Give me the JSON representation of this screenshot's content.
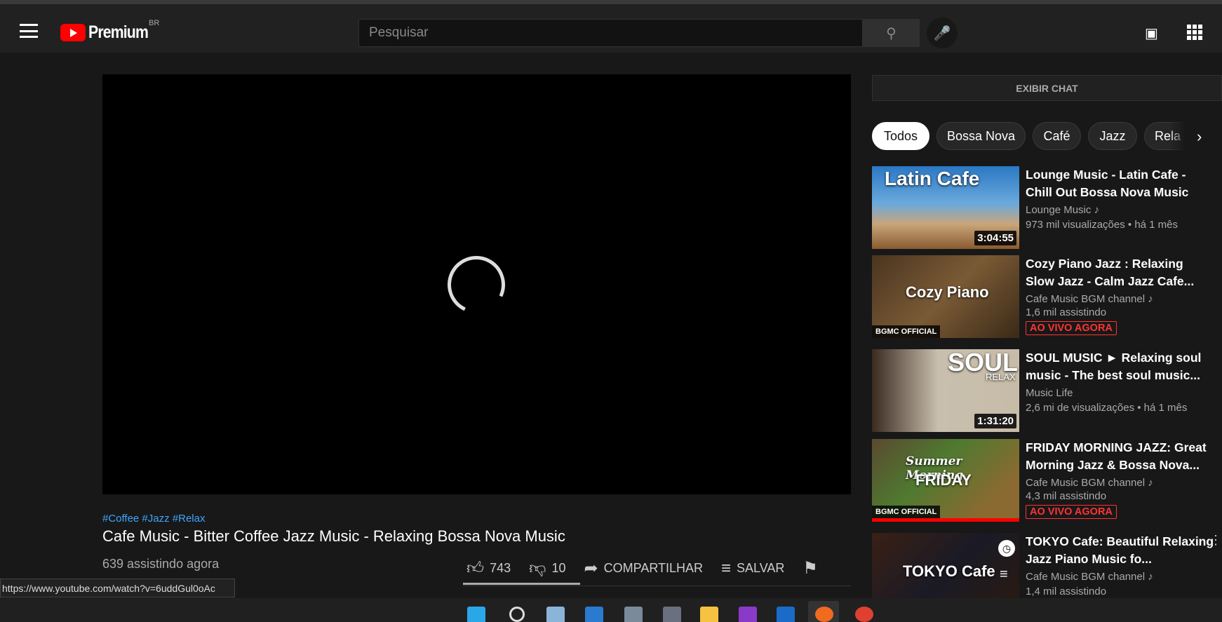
{
  "header": {
    "logo_text": "Premium",
    "region": "BR",
    "search_placeholder": "Pesquisar"
  },
  "video": {
    "hashtags": "#Coffee #Jazz #Relax",
    "title": "Cafe Music - Bitter Coffee Jazz Music - Relaxing Bossa Nova Music",
    "viewers": "639 assistindo agora",
    "likes": "743",
    "dislikes": "10",
    "share_label": "COMPARTILHAR",
    "save_label": "SALVAR"
  },
  "status_url": "https://www.youtube.com/watch?v=6uddGul0oAc",
  "sidebar": {
    "chat_button": "EXIBIR CHAT",
    "chips": [
      "Todos",
      "Bossa Nova",
      "Café",
      "Jazz",
      "Rela"
    ],
    "videos": [
      {
        "thumb_text": "Latin Cafe",
        "title": "Lounge Music - Latin Cafe - Chill Out Bossa Nova Music",
        "channel": "Lounge Music",
        "meta": "973 mil visualizações • há 1 mês",
        "duration": "3:04:55"
      },
      {
        "thumb_text": "Cozy Piano",
        "badge": "BGMC OFFICIAL",
        "title": "Cozy Piano Jazz : Relaxing Slow Jazz - Calm Jazz Cafe...",
        "channel": "Cafe Music BGM channel",
        "meta": "1,6 mil assistindo",
        "live": "AO VIVO AGORA"
      },
      {
        "thumb_text": "SOUL",
        "thumb_sub": "RELAX",
        "title": "SOUL MUSIC ► Relaxing soul music - The best soul music...",
        "channel": "Music Life",
        "meta": "2,6 mi de visualizações • há 1 mês",
        "duration": "1:31:20"
      },
      {
        "thumb_text": "FRIDAY",
        "thumb_sub": "Summer Morning",
        "badge": "BGMC OFFICIAL",
        "title": "FRIDAY MORNING JAZZ: Great Morning Jazz & Bossa Nova...",
        "channel": "Cafe Music BGM channel",
        "meta": "4,3 mil assistindo",
        "live": "AO VIVO AGORA"
      },
      {
        "thumb_text": "TOKYO Cafe",
        "title": "TOKYO Cafe: Beautiful Relaxing Jazz Piano Music fo...",
        "channel": "Cafe Music BGM channel",
        "meta": "1,4 mil assistindo"
      }
    ]
  }
}
